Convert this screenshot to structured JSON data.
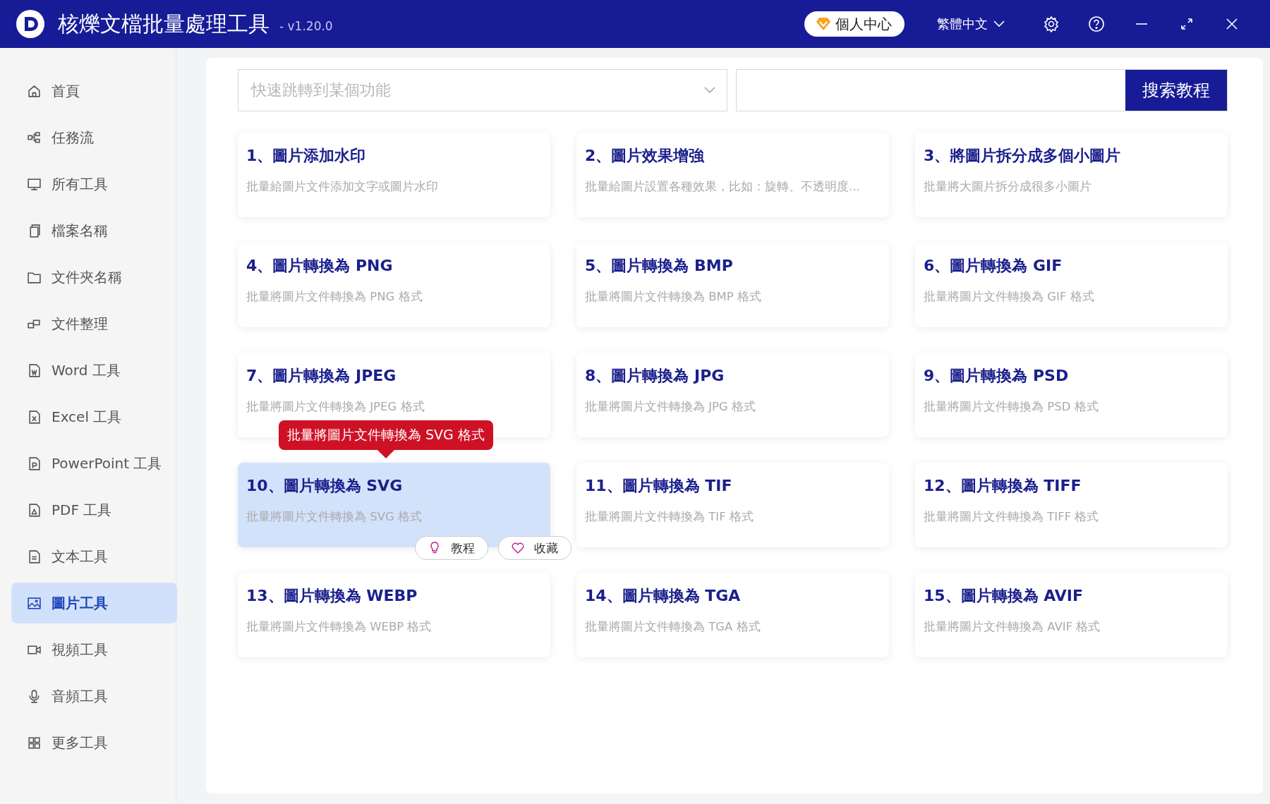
{
  "window": {
    "title": "核爍文檔批量處理工具",
    "version": "- v1.20.0",
    "user_button": "個人中心",
    "language": "繁體中文"
  },
  "sidebar": {
    "items": [
      {
        "label": "首頁",
        "selected": false
      },
      {
        "label": "任務流",
        "selected": false
      },
      {
        "label": "所有工具",
        "selected": false
      },
      {
        "label": "檔案名稱",
        "selected": false
      },
      {
        "label": "文件夾名稱",
        "selected": false
      },
      {
        "label": "文件整理",
        "selected": false
      },
      {
        "label": "Word 工具",
        "selected": false
      },
      {
        "label": "Excel 工具",
        "selected": false
      },
      {
        "label": "PowerPoint 工具",
        "selected": false
      },
      {
        "label": "PDF 工具",
        "selected": false
      },
      {
        "label": "文本工具",
        "selected": false
      },
      {
        "label": "圖片工具",
        "selected": true
      },
      {
        "label": "視頻工具",
        "selected": false
      },
      {
        "label": "音頻工具",
        "selected": false
      },
      {
        "label": "更多工具",
        "selected": false
      }
    ]
  },
  "search": {
    "placeholder": "快速跳轉到某個功能",
    "button": "搜索教程"
  },
  "cards": [
    {
      "title": "1、圖片添加水印",
      "description": "批量給圖片文件添加文字或圖片水印",
      "selected": false
    },
    {
      "title": "2、圖片效果增強",
      "description": "批量給圖片設置各種效果，比如：旋轉、不透明度...",
      "selected": false
    },
    {
      "title": "3、將圖片拆分成多個小圖片",
      "description": "批量將大圖片拆分成很多小圖片",
      "selected": false
    },
    {
      "title": "4、圖片轉換為 PNG",
      "description": "批量將圖片文件轉換為 PNG 格式",
      "selected": false
    },
    {
      "title": "5、圖片轉換為 BMP",
      "description": "批量將圖片文件轉換為 BMP 格式",
      "selected": false
    },
    {
      "title": "6、圖片轉換為 GIF",
      "description": "批量將圖片文件轉換為 GIF 格式",
      "selected": false
    },
    {
      "title": "7、圖片轉換為 JPEG",
      "description": "批量將圖片文件轉換為 JPEG 格式",
      "selected": false
    },
    {
      "title": "8、圖片轉換為 JPG",
      "description": "批量將圖片文件轉換為 JPG 格式",
      "selected": false
    },
    {
      "title": "9、圖片轉換為 PSD",
      "description": "批量將圖片文件轉換為 PSD 格式",
      "selected": false
    },
    {
      "title": "10、圖片轉換為 SVG",
      "description": "批量將圖片文件轉換為 SVG 格式",
      "selected": true,
      "tooltip": "批量將圖片文件轉換為 SVG 格式",
      "actions": [
        "教程",
        "收藏"
      ]
    },
    {
      "title": "11、圖片轉換為 TIF",
      "description": "批量將圖片文件轉換為 TIF 格式",
      "selected": false
    },
    {
      "title": "12、圖片轉換為 TIFF",
      "description": "批量將圖片文件轉換為 TIFF 格式",
      "selected": false
    },
    {
      "title": "13、圖片轉換為 WEBP",
      "description": "批量將圖片文件轉換為 WEBP 格式",
      "selected": false
    },
    {
      "title": "14、圖片轉換為 TGA",
      "description": "批量將圖片文件轉換為 TGA 格式",
      "selected": false
    },
    {
      "title": "15、圖片轉換為 AVIF",
      "description": "批量將圖片文件轉換為 AVIF 格式",
      "selected": false
    }
  ]
}
